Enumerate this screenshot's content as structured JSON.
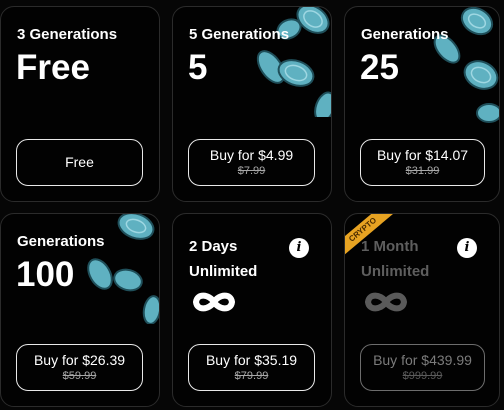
{
  "colors": {
    "background": "#060606",
    "card_border": "#2b2b2b",
    "accent_teal": "#5fb1c1",
    "crypto_badge": "#e7a322"
  },
  "plans": [
    {
      "title": "3 Generations",
      "amount": "Free",
      "button_label": "Free"
    },
    {
      "title": "5 Generations",
      "amount": "5",
      "button_label": "Buy for $4.99",
      "old_price": "$7.99",
      "decoration": "teal-disc-icons"
    },
    {
      "title": "Generations",
      "amount": "25",
      "button_label": "Buy for $14.07",
      "old_price": "$31.99",
      "decoration": "teal-disc-icons"
    },
    {
      "title": "Generations",
      "amount": "100",
      "button_label": "Buy for $26.39",
      "old_price": "$59.99",
      "decoration": "teal-disc-icons"
    },
    {
      "title_line1": "2 Days",
      "title_line2": "Unlimited",
      "icon": "infinity-icon",
      "info": "i",
      "button_label": "Buy for $35.19",
      "old_price": "$79.99"
    },
    {
      "badge": "CRYPTO",
      "title_line1": "1 Month",
      "title_line2": "Unlimited",
      "icon": "infinity-icon",
      "info": "i",
      "button_label": "Buy for $439.99",
      "old_price": "$999.99",
      "state": "disabled"
    }
  ]
}
